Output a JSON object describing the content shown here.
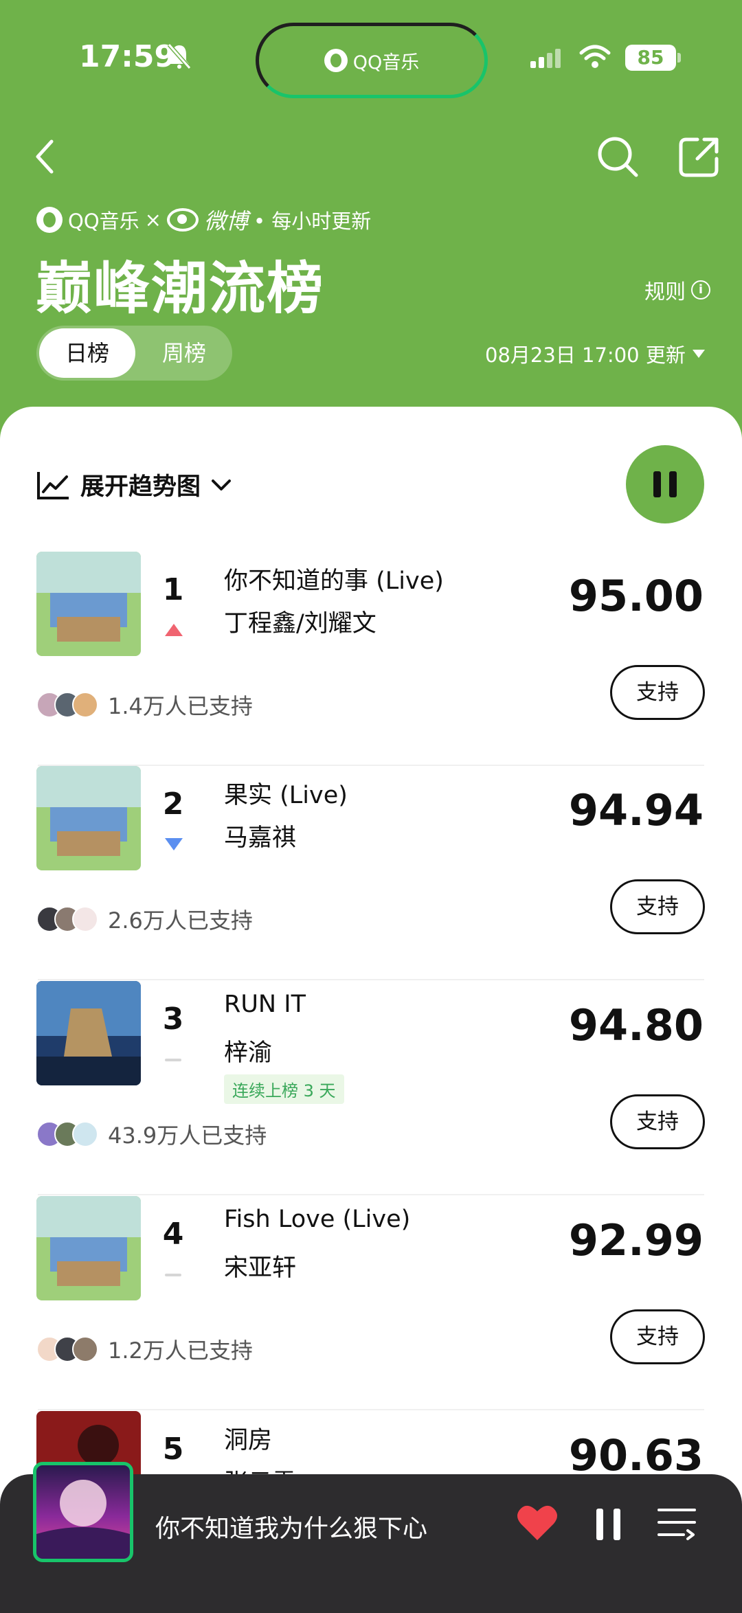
{
  "status_bar": {
    "time": "17:59",
    "island_app": "QQ音乐",
    "battery": "85"
  },
  "header": {
    "brand_qq": "QQ音乐",
    "brand_cross": "×",
    "brand_weibo": "微博",
    "update_freq": "• 每小时更新",
    "title": "巅峰潮流榜",
    "rules": "规则",
    "tabs": [
      {
        "label": "日榜",
        "active": true
      },
      {
        "label": "周榜",
        "active": false
      }
    ],
    "update_time": "08月23日 17:00 更新"
  },
  "chart_toggle": {
    "label": "展开趋势图"
  },
  "songs": [
    {
      "rank": "1",
      "trend": "up",
      "title": "你不知道的事 (Live)",
      "artist": "丁程鑫/刘耀文",
      "score": "95.00",
      "supporters": "1.4万人已支持",
      "support_label": "支持",
      "cover": "green"
    },
    {
      "rank": "2",
      "trend": "down",
      "title": "果实 (Live)",
      "artist": "马嘉祺",
      "score": "94.94",
      "supporters": "2.6万人已支持",
      "support_label": "支持",
      "cover": "green"
    },
    {
      "rank": "3",
      "trend": "flat",
      "title": "RUN IT",
      "artist": "梓渝",
      "badge": "连续上榜 3 天",
      "score": "94.80",
      "supporters": "43.9万人已支持",
      "support_label": "支持",
      "cover": "blue"
    },
    {
      "rank": "4",
      "trend": "flat",
      "title": "Fish Love (Live)",
      "artist": "宋亚轩",
      "score": "92.99",
      "supporters": "1.2万人已支持",
      "support_label": "支持",
      "cover": "green"
    },
    {
      "rank": "5",
      "trend": "flat",
      "title": "洞房",
      "artist": "张云雷",
      "score": "90.63",
      "cover": "red"
    }
  ],
  "mini_player": {
    "title": "你不知道我为什么狠下心"
  },
  "colors": {
    "brand_green": "#6fb24a",
    "up": "#f06470",
    "down": "#5b8ff0",
    "accent_green": "#18c46a"
  }
}
